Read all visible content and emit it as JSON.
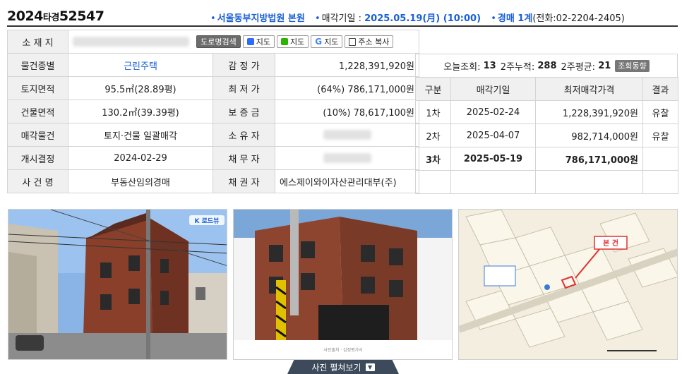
{
  "header": {
    "case_year": "2024",
    "case_type": "타경",
    "case_num": "52547",
    "court": "서울동부지방법원 본원",
    "sale_date_label": "매각기일 : ",
    "sale_date": "2025.05.19(月) (10:00)",
    "dept": "경매 1계",
    "phone": "(전화:02-2204-2405)"
  },
  "address_row": {
    "label": "소 재 지",
    "buttons": {
      "road": "도로명검색",
      "daum": "지도",
      "naver": "지도",
      "google": "지도",
      "copy": "주소 복사"
    }
  },
  "left_rows": [
    {
      "label": "물건종별",
      "value": "근린주택",
      "label2": "감 정 가",
      "value2": "1,228,391,920원"
    },
    {
      "label": "토지면적",
      "value": "95.5㎡(28.89평)",
      "label2": "최 저 가",
      "value2": "(64%) 786,171,000원"
    },
    {
      "label": "건물면적",
      "value": "130.2㎡(39.39평)",
      "label2": "보 증 금",
      "value2": "(10%) 78,617,100원"
    },
    {
      "label": "매각물건",
      "value": "토지·건물 일괄매각",
      "label2": "소 유 자",
      "value2": ""
    },
    {
      "label": "개시결정",
      "value": "2024-02-29",
      "label2": "채 무 자",
      "value2": ""
    },
    {
      "label": "사 건 명",
      "value": "부동산임의경매",
      "label2": "채 권 자",
      "value2": "에스제이와이자산관리대부(주)"
    }
  ],
  "views": {
    "today_label": "오늘조회:",
    "today": "13",
    "week2_label": "2주누적:",
    "week2": "288",
    "avg_label": "2주평균:",
    "avg": "21",
    "trend_button": "조회동향"
  },
  "history": {
    "headers": [
      "구분",
      "매각기일",
      "최저매각가격",
      "결과"
    ],
    "rows": [
      {
        "round": "1차",
        "date": "2025-02-24",
        "price": "1,228,391,920원",
        "result": "유찰"
      },
      {
        "round": "2차",
        "date": "2025-04-07",
        "price": "982,714,000원",
        "result": "유찰"
      },
      {
        "round": "3차",
        "date": "2025-05-19",
        "price": "786,171,000원",
        "result": ""
      }
    ]
  },
  "photos": {
    "roadview_badge": "K 로드뷰",
    "map_label": "본 건",
    "caption": "사진출처 · 감정평가서"
  },
  "toggle_label": "사진 펼쳐보기"
}
